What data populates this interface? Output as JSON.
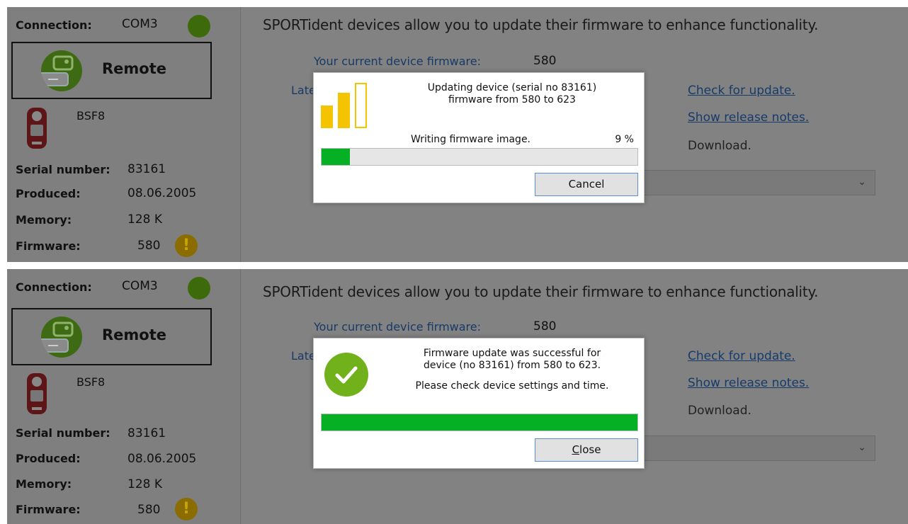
{
  "colors": {
    "connection_status": "#3d6b0b",
    "warning": "#c9a500",
    "progress": "#06b025",
    "bars": "#f5c400",
    "success": "#71b11c"
  },
  "screens": [
    {
      "sidebar": {
        "connection_label": "Connection:",
        "connection_value": "COM3",
        "mode_label": "Remote",
        "device_name": "BSF8",
        "serial_label": "Serial number:",
        "serial_value": "83161",
        "produced_label": "Produced:",
        "produced_value": "08.06.2005",
        "memory_label": "Memory:",
        "memory_value": "128 K",
        "firmware_label": "Firmware:",
        "firmware_value": "580",
        "warning_icon": "!"
      },
      "main": {
        "headline": "SPORTident devices allow you to update their firmware to enhance functionality.",
        "current_fw_label": "Your current device firmware:",
        "current_fw_value": "580",
        "latest_label": "Late",
        "check_update_link": "Check for update.",
        "release_notes_link": "Show release notes.",
        "download_text": "Download."
      },
      "dialog": {
        "icon": "signal-bars-icon",
        "message_line1": "Updating device (serial no 83161)",
        "message_line2": "firmware from 580 to 623",
        "status": "Writing firmware image.",
        "percent": "9 %",
        "progress": 0.09,
        "button_label": "Cancel"
      }
    },
    {
      "sidebar": {
        "connection_label": "Connection:",
        "connection_value": "COM3",
        "mode_label": "Remote",
        "device_name": "BSF8",
        "serial_label": "Serial number:",
        "serial_value": "83161",
        "produced_label": "Produced:",
        "produced_value": "08.06.2005",
        "memory_label": "Memory:",
        "memory_value": "128 K",
        "firmware_label": "Firmware:",
        "firmware_value": "580",
        "warning_icon": "!"
      },
      "main": {
        "headline": "SPORTident devices allow you to update their firmware to enhance functionality.",
        "current_fw_label": "Your current device firmware:",
        "current_fw_value": "580",
        "latest_label": "Late",
        "check_update_link": "Check for update.",
        "release_notes_link": "Show release notes.",
        "download_text": "Download."
      },
      "dialog": {
        "icon": "success-check-icon",
        "message_line1": "Firmware update was successful for",
        "message_line2": "device (no 83161) from 580 to 623.",
        "message_line3": "Please check device settings and time.",
        "progress": 1.0,
        "button_label": "Close",
        "button_mnemonic": "C",
        "button_rest": "lose"
      }
    }
  ]
}
